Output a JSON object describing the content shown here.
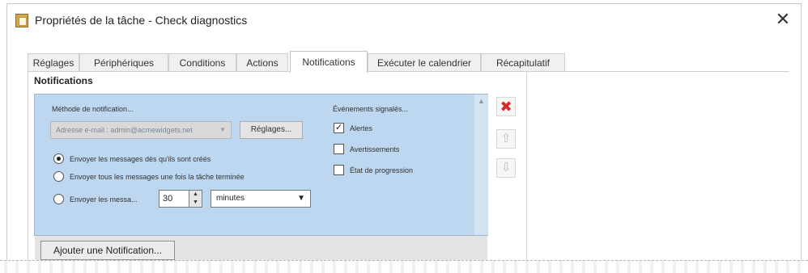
{
  "window": {
    "title": "Propriétés de la tâche - Check diagnostics",
    "close_glyph": "✕"
  },
  "tabs": [
    {
      "label": "Réglages"
    },
    {
      "label": "Périphériques"
    },
    {
      "label": "Conditions"
    },
    {
      "label": "Actions"
    },
    {
      "label": "Notifications",
      "active": true
    },
    {
      "label": "Exécuter le calendrier"
    },
    {
      "label": "Récapitulatif"
    }
  ],
  "notifications": {
    "heading": "Notifications",
    "method_label": "Méthode de notification...",
    "email_select_value": "Adresse e-mail : admin@acmewidgets.net",
    "settings_button": "Réglages...",
    "radio_options": [
      {
        "label": "Envoyer les messages dès qu'ils sont créés",
        "checked": true
      },
      {
        "label": "Envoyer tous les messages une fois la tâche terminée",
        "checked": false
      },
      {
        "label": "Envoyer les messa...",
        "checked": false
      }
    ],
    "interval_value": "30",
    "interval_unit": "minutes",
    "events_label": "Événements signalés...",
    "events": [
      {
        "label": "Alertes",
        "checked": true
      },
      {
        "label": "Avertissements",
        "checked": false
      },
      {
        "label": "État de progression",
        "checked": false
      }
    ],
    "add_button": "Ajouter une Notification..."
  },
  "side_buttons": {
    "delete_glyph": "✖",
    "up_glyph": "⇧",
    "down_glyph": "⇩"
  },
  "icons": [
    "task-properties-icon",
    "close-icon",
    "delete-icon",
    "move-up-icon",
    "move-down-icon"
  ],
  "colors": {
    "panel_background": "#bcd7ef",
    "delete_red": "#d42a2a"
  }
}
